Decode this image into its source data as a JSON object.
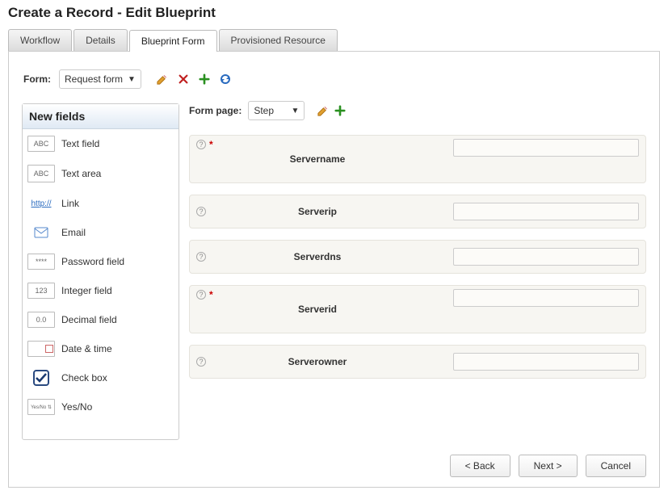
{
  "page_title": "Create a Record - Edit Blueprint",
  "tabs": [
    {
      "label": "Workflow",
      "active": false
    },
    {
      "label": "Details",
      "active": false
    },
    {
      "label": "Blueprint Form",
      "active": true
    },
    {
      "label": "Provisioned Resource",
      "active": false
    }
  ],
  "form_selector": {
    "label": "Form:",
    "value": "Request form"
  },
  "sidebar": {
    "title": "New fields",
    "items": [
      {
        "label": "Text field",
        "icon_text": "ABC",
        "type": "text"
      },
      {
        "label": "Text area",
        "icon_text": "ABC",
        "type": "textarea"
      },
      {
        "label": "Link",
        "icon_text": "http://",
        "type": "link"
      },
      {
        "label": "Email",
        "icon_text": "",
        "type": "email"
      },
      {
        "label": "Password field",
        "icon_text": "****",
        "type": "password"
      },
      {
        "label": "Integer field",
        "icon_text": "123",
        "type": "integer"
      },
      {
        "label": "Decimal field",
        "icon_text": "0.0",
        "type": "decimal"
      },
      {
        "label": "Date & time",
        "icon_text": "",
        "type": "datetime"
      },
      {
        "label": "Check box",
        "icon_text": "",
        "type": "checkbox"
      },
      {
        "label": "Yes/No",
        "icon_text": "Yes/No ⇅",
        "type": "yesno"
      }
    ]
  },
  "form_page": {
    "label": "Form page:",
    "value": "Step"
  },
  "fields": [
    {
      "label": "Servername",
      "required": true,
      "tall": true
    },
    {
      "label": "Serverip",
      "required": false,
      "tall": false
    },
    {
      "label": "Serverdns",
      "required": false,
      "tall": false
    },
    {
      "label": "Serverid",
      "required": true,
      "tall": true
    },
    {
      "label": "Serverowner",
      "required": false,
      "tall": false
    }
  ],
  "footer": {
    "back": "< Back",
    "next": "Next >",
    "cancel": "Cancel"
  }
}
